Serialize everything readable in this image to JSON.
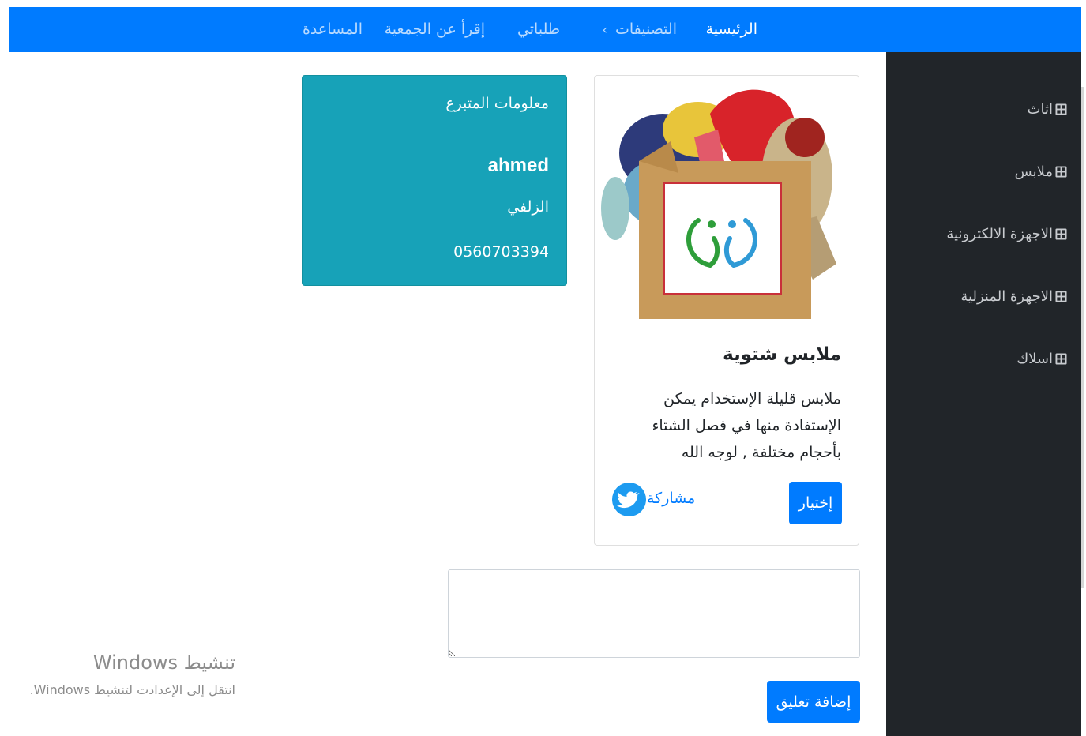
{
  "nav": {
    "home": "الرئيسية",
    "categories": "التصنيفات",
    "categories_chevron": "›",
    "my_requests": "طلباتي",
    "about": "إقرأ عن الجمعية",
    "help": "المساعدة"
  },
  "sidebar": {
    "items": [
      {
        "label": "اثاث",
        "icon": "grid-icon"
      },
      {
        "label": "ملابس",
        "icon": "grid-icon"
      },
      {
        "label": "الاجهزة الالكترونية",
        "icon": "grid-icon"
      },
      {
        "label": "الاجهزة المنزلية",
        "icon": "grid-icon"
      },
      {
        "label": "اسلاك",
        "icon": "grid-icon"
      }
    ]
  },
  "product": {
    "title": "ملابس شتوية",
    "description": "ملابس قليلة الإستخدام يمكن الإستفادة منها في فصل الشتاء بأحجام مختلفة , لوجه الله",
    "choose_label": "إختيار",
    "share_label": "مشاركة",
    "image_icon": "clothes-donation-box"
  },
  "donor": {
    "header": "معلومات المتبرع",
    "name": "ahmed",
    "city": "الزلفي",
    "phone": "0560703394"
  },
  "comment": {
    "value": "",
    "add_label": "إضافة تعليق"
  },
  "windows_watermark": {
    "title": "تنشيط Windows",
    "subtitle": "انتقل إلى الإعدادت لتنشيط Windows."
  },
  "colors": {
    "primary": "#007bff",
    "info": "#17a2b8",
    "sidebar": "#212529",
    "twitter": "#1d9bf0"
  }
}
